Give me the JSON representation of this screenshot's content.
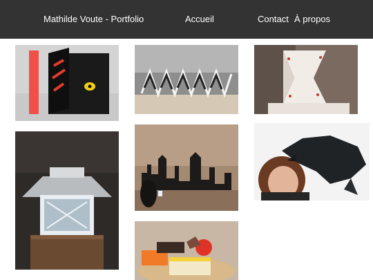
{
  "nav": {
    "title": "Mathilde Voute - Portfolio",
    "home": "Accueil",
    "contact": "Contact",
    "about": "À propos"
  },
  "gallery": [
    {
      "subject": "red and black pop-up book with yellow eye"
    },
    {
      "subject": "black and white accordion book"
    },
    {
      "subject": "white folded paper lantern sculpture"
    },
    {
      "subject": "illuminated paper lantern on pedestal"
    },
    {
      "subject": "London skyline paper cut-out shadow theatre"
    },
    {
      "subject": "person with black crow paper sculpture"
    },
    {
      "subject": "colorful paper pastry sculptures"
    }
  ],
  "colors": {
    "nav_background": "#333333",
    "nav_text": "#ffffff",
    "page_background": "#ffffff"
  }
}
